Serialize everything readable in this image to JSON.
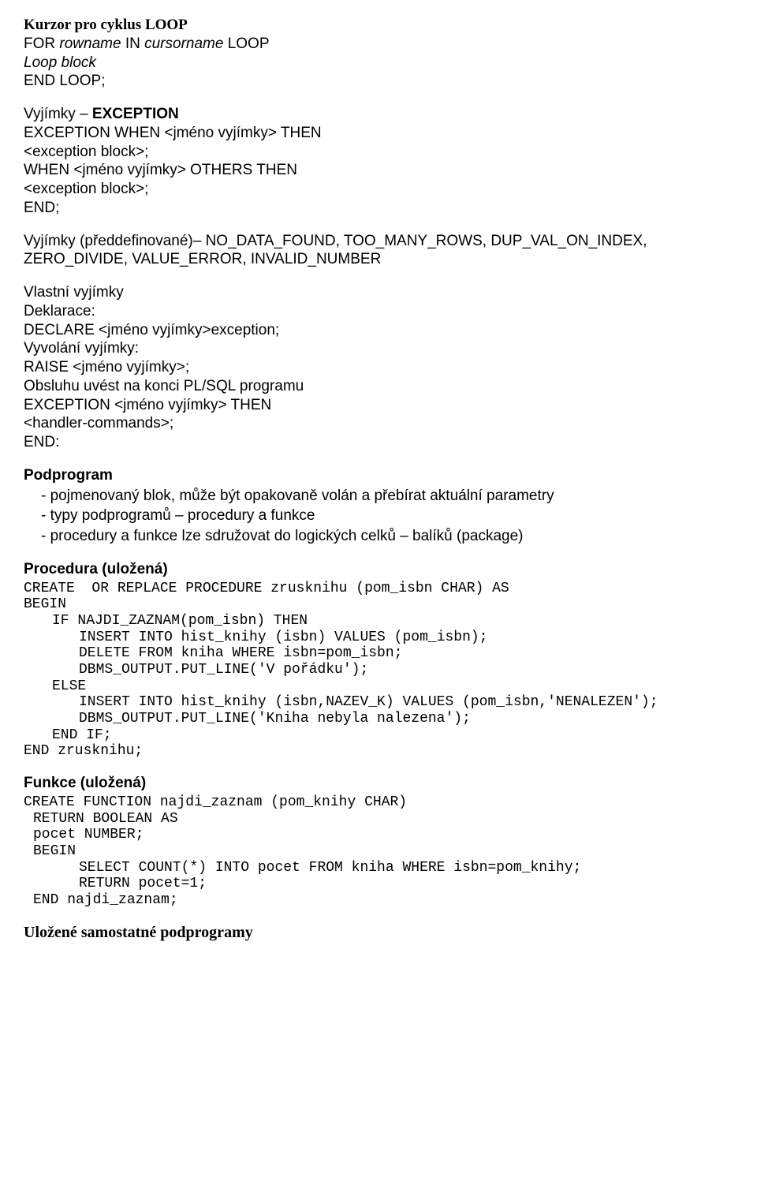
{
  "l1": {
    "title": "Kurzor pro cyklus LOOP",
    "line1a": "FOR ",
    "line1b": "rowname",
    "line1c": " IN ",
    "line1d": "cursorname",
    "line1e": " LOOP",
    "line2": "Loop block",
    "line3": "END LOOP;"
  },
  "l2": {
    "line1a": "Vyjímky – ",
    "line1b": "EXCEPTION",
    "line2": "EXCEPTION WHEN <jméno vyjímky> THEN",
    "line3": "<exception block>;",
    "line4": "WHEN <jméno vyjímky> OTHERS THEN",
    "line5": "<exception block>;",
    "line6": "END;"
  },
  "l3": {
    "line1": "Vyjímky (předdefinované)– NO_DATA_FOUND, TOO_MANY_ROWS, DUP_VAL_ON_INDEX, ZERO_DIVIDE, VALUE_ERROR, INVALID_NUMBER"
  },
  "l4": {
    "line1": "Vlastní vyjímky",
    "line2": "Deklarace:",
    "line3": "DECLARE <jméno vyjímky>exception;",
    "line4": "Vyvolání vyjímky:",
    "line5": "RAISE <jméno vyjímky>;",
    "line6": "Obsluhu uvést na konci PL/SQL programu",
    "line7": "EXCEPTION <jméno vyjímky> THEN",
    "line8": "<handler-commands>;",
    "line9": "END:"
  },
  "podprogram": {
    "heading": "Podprogram",
    "items": [
      "pojmenovaný blok, může být opakovaně volán a přebírat aktuální parametry",
      "typy podprogramů – procedury a funkce",
      "procedury a funkce lze sdružovat do logických celků – balíků (package)"
    ]
  },
  "proc": {
    "heading": "Procedura (uložená)",
    "c1": "CREATE  OR REPLACE PROCEDURE zrusknihu (pom_isbn CHAR) AS",
    "c2": "BEGIN",
    "c3": "IF NAJDI_ZAZNAM(pom_isbn) THEN",
    "c4": "INSERT INTO hist_knihy (isbn) VALUES (pom_isbn);",
    "c5": "DELETE FROM kniha WHERE isbn=pom_isbn;",
    "c6": "DBMS_OUTPUT.PUT_LINE('V pořádku');",
    "c7": "ELSE",
    "c8": "INSERT INTO hist_knihy (isbn,NAZEV_K) VALUES (pom_isbn,'NENALEZEN');",
    "c9": "DBMS_OUTPUT.PUT_LINE('Kniha nebyla nalezena');",
    "c10": "END IF;",
    "c11": "END zrusknihu;"
  },
  "func": {
    "heading": "Funkce (uložená)",
    "c1": "CREATE FUNCTION najdi_zaznam (pom_knihy CHAR)",
    "c2": "RETURN BOOLEAN AS",
    "c3": "pocet NUMBER;",
    "c4": "BEGIN",
    "c5": "SELECT COUNT(*) INTO pocet FROM kniha WHERE isbn=pom_knihy;",
    "c6": "RETURN pocet=1;",
    "c7": "END najdi_zaznam;"
  },
  "last": {
    "heading": "Uložené samostatné podprogramy"
  }
}
